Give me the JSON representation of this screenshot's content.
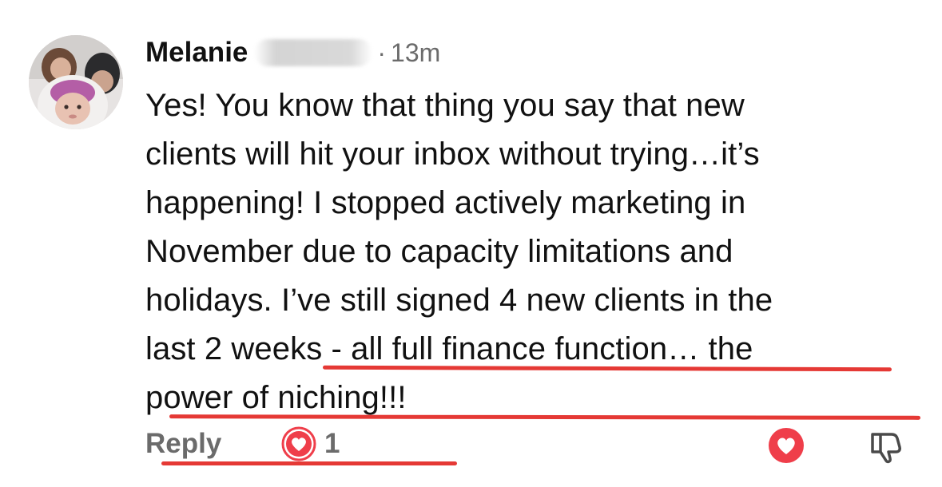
{
  "comment": {
    "author": "Melanie",
    "meta_separator": "·",
    "timestamp": "13m",
    "lines": [
      "Yes! You know that thing you say that new",
      "clients will hit your inbox without trying…it’s",
      "happening! I stopped actively marketing in",
      "November due to capacity limitations and",
      "holidays.  I’ve still signed 4 new clients in the",
      "last 2 weeks - all full finance function… the",
      "power of niching!!!"
    ]
  },
  "actions": {
    "reply_label": "Reply",
    "reaction_count": "1"
  },
  "colors": {
    "underline": "#e53935",
    "reaction_red": "#ef3e4a",
    "muted_text": "#6b6b6b"
  },
  "icons": {
    "reaction": "heart-reaction-icon",
    "love": "heart-button-icon",
    "dislike": "thumbs-down-icon"
  }
}
